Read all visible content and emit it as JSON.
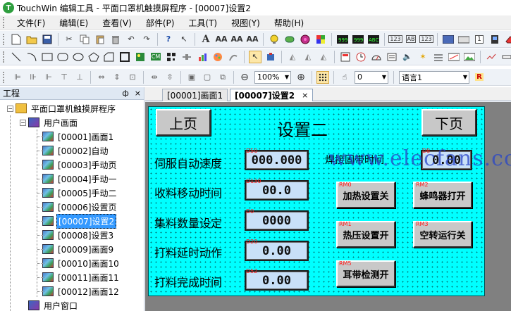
{
  "window": {
    "title": "TouchWin 编辑工具 - 平面口罩机触摸屏程序 - [00007]设置2",
    "icon_letter": "T"
  },
  "menu": [
    "文件(F)",
    "编辑(E)",
    "查看(V)",
    "部件(P)",
    "工具(T)",
    "视图(Y)",
    "帮助(H)"
  ],
  "toolbar": {
    "zoom": "100%",
    "layer": "0",
    "language": "语言1"
  },
  "panel": {
    "title": "工程",
    "pin": "ф",
    "close": "×"
  },
  "tree": {
    "root": "平面口罩机触摸屏程序",
    "user_screens": "用户画面",
    "screens": [
      "[00001]画面1",
      "[00002]自动",
      "[00003]手动页",
      "[00004]手动一",
      "[00005]手动二",
      "[00006]设置页",
      "[00007]设置2",
      "[00008]设置3",
      "[00009]画面9",
      "[00010]画面10",
      "[00011]画面11",
      "[00012]画面12"
    ],
    "user_windows": "用户窗口"
  },
  "tabs": [
    {
      "label": "[00001]画面1"
    },
    {
      "label": "[00007]设置2",
      "close": "×"
    }
  ],
  "hmi": {
    "prev_button": "上页",
    "next_button": "下页",
    "title": "设置二",
    "labels": {
      "servo_speed": "伺服自动速度",
      "collect_time": "收料移动时间",
      "collect_count": "集料数量设定",
      "punch_delay": "打料延时动作",
      "punch_done": "打料完成时间",
      "weld_fix_time": "焊接固带时间"
    },
    "fields": {
      "servo_speed": {
        "tag": "D50",
        "value": "000.000"
      },
      "collect_time": {
        "tag": "D130",
        "value": "00.0"
      },
      "collect_count": {
        "tag": "D0",
        "value": "0000"
      },
      "punch_delay": {
        "tag": "D20",
        "value": "0.00"
      },
      "punch_done": {
        "tag": "D52",
        "value": "0.00"
      },
      "weld_fix_time": {
        "tag": "D8",
        "value": "0.00"
      }
    },
    "buttons": {
      "heat_set": {
        "tag": "RM0",
        "label": "加热设置关"
      },
      "buzzer": {
        "tag": "RM2",
        "label": "蜂鸣器打开"
      },
      "press_set": {
        "tag": "RM1",
        "label": "热压设置开"
      },
      "idle_run": {
        "tag": "RM3",
        "label": "空转运行关"
      },
      "ear_check": {
        "tag": "RM5",
        "label": "耳带检测开"
      }
    },
    "watermark": "www.elecfans.com"
  }
}
